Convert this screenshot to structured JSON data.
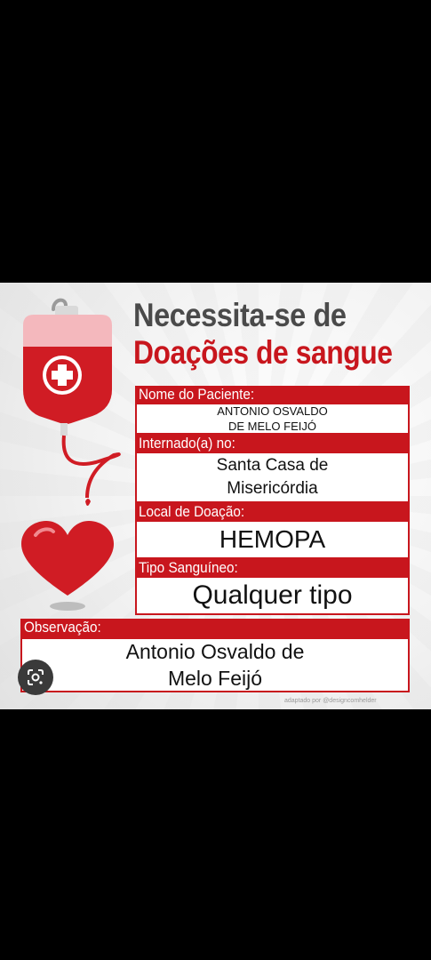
{
  "poster": {
    "title_line1": "Necessita-se de",
    "title_line2": "Doações de sangue",
    "patient": {
      "label": "Nome do Paciente:",
      "line1": "ANTONIO OSVALDO",
      "line2": "DE MELO FEIJÓ"
    },
    "hospital": {
      "label": "Internado(a) no:",
      "line1": "Santa Casa de",
      "line2": "Misericórdia"
    },
    "location": {
      "label": "Local de Doação:",
      "value": "HEMOPA"
    },
    "blood_type": {
      "label": "Tipo Sanguíneo:",
      "value": "Qualquer tipo"
    },
    "observation": {
      "label": "Observação:",
      "line1": "Antonio Osvaldo de",
      "line2": "Melo Feijó"
    },
    "credit": "adaptado por @designcomhelder"
  },
  "colors": {
    "brand_red": "#c8161d",
    "title_gray": "#4a4a4a",
    "background": "#000000"
  },
  "icons": {
    "bag": "blood-bag-icon",
    "heart": "heart-icon",
    "lens": "google-lens-icon"
  }
}
